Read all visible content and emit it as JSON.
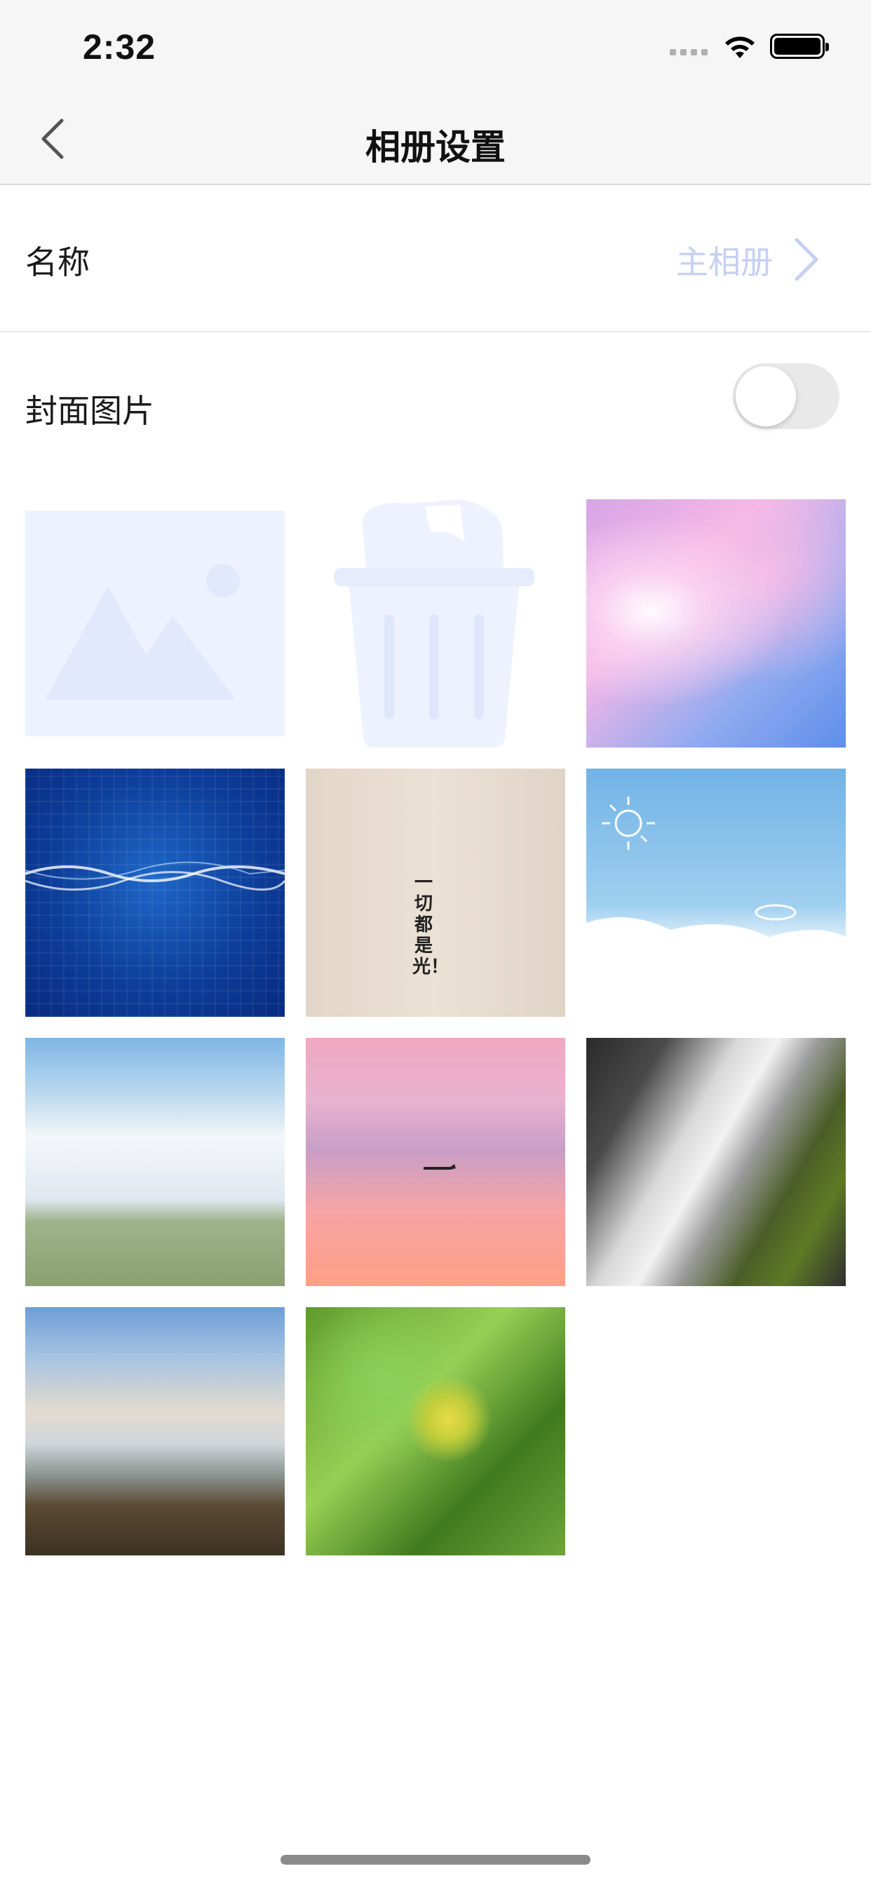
{
  "status_bar": {
    "time": "2:32"
  },
  "nav": {
    "title": "相册设置",
    "back_icon": "chevron-left-icon"
  },
  "settings": {
    "name_label": "名称",
    "name_value": "主相册",
    "cover_label": "封面图片",
    "cover_enabled": false
  },
  "grid": {
    "tiles": [
      {
        "kind": "placeholder",
        "icon": "image-placeholder-icon"
      },
      {
        "kind": "action",
        "icon": "trash-icon"
      },
      {
        "kind": "photo",
        "subject": "pink clouds sky"
      },
      {
        "kind": "photo",
        "subject": "blue digital wave"
      },
      {
        "kind": "photo",
        "subject": "light text",
        "text": "一切都是光！"
      },
      {
        "kind": "photo",
        "subject": "cartoon sky doodles"
      },
      {
        "kind": "photo",
        "subject": "grass field with clouds"
      },
      {
        "kind": "photo",
        "subject": "pink sunset with airplane"
      },
      {
        "kind": "photo",
        "subject": "waterfall over mossy rocks"
      },
      {
        "kind": "photo",
        "subject": "waterfall coastline"
      },
      {
        "kind": "photo",
        "subject": "green leaves"
      }
    ]
  },
  "colors": {
    "accent_light": "#c5d0f2",
    "placeholder_bg": "#eef2fe",
    "nav_bg": "#f6f6f6",
    "toggle_off": "#e9e9ea"
  }
}
